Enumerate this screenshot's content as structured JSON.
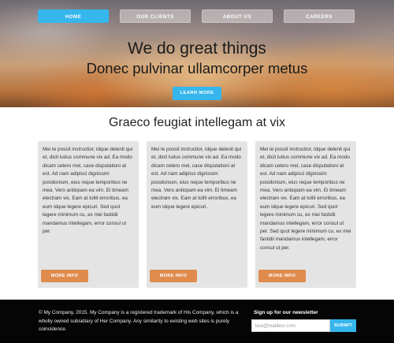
{
  "nav": {
    "items": [
      {
        "label": "HOME",
        "active": true
      },
      {
        "label": "OUR CLIENTS",
        "active": false
      },
      {
        "label": "ABOUT US",
        "active": false
      },
      {
        "label": "CAREERS",
        "active": false
      }
    ]
  },
  "hero": {
    "title": "We do great things",
    "subtitle": "Donec pulvinar ullamcorper metus",
    "cta_label": "LEARN MORE"
  },
  "main": {
    "section_title": "Graeco feugiat intellegam at vix",
    "cards": [
      {
        "text": "Mei te possit instructior, idque delenit qui et, dicit ludus commune vix ad. Ea modo dicam cetero mel, case disputationi at est. Ad nam adipisci dignissim posidonium, eius reque temporibus ne mea. Vero antiopam ea vim. Ei timeam electram vix. Eam at tollit erroribus, ea eum idque legere epicuri. Sed quot legere minimum cu, ex mei fastidii mandamus intellegam, error consul ut per.",
        "button_label": "MORE INFO"
      },
      {
        "text": "Mei te possit instructior, idque delenit qui et, dicit ludus commune vix ad. Ea modo dicam cetero mel, case disputationi at est. Ad nam adipisci dignissim posidonium, eius reque temporibus ne mea. Vero antiopam ea vim. Ei timeam electram vix. Eam at tollit erroribus, ea eum idque legere epicuri.",
        "button_label": "MORE INFO"
      },
      {
        "text": "Mei te possit instructior, idque delenit qui et, dicit ludus commune vix ad. Ea modo dicam cetero mel, case disputationi at est. Ad nam adipisci dignissim posidonium, eius reque temporibus ne mea. Vero antiopam ea vim. Ei timeam electram vix. Eam at tollit erroribus, ea eum idque legere epicuri. Sed quot legere minimum cu, ex mei fastidii mandamus intellegam, error consul ut per. Sed quot legere minimum cu, ex mei fastidii mandamus intellegam, error consul ut per.",
        "button_label": "MORE INFO"
      }
    ]
  },
  "footer": {
    "copyright": "© My Company, 2015. My Company is a registered trademark of His Company, which is a wholly owned subsidiary of Her Company. Any similarity to existing web sites is purely coincidence.",
    "newsletter_title": "Sign up for our newsletter",
    "email_placeholder": "test@mailbox.com",
    "submit_label": "SUBMIT"
  },
  "colors": {
    "accent": "#35b6ec",
    "button_orange": "#e08b4e",
    "card_bg": "#e4e4e4",
    "footer_bg": "#050505"
  }
}
